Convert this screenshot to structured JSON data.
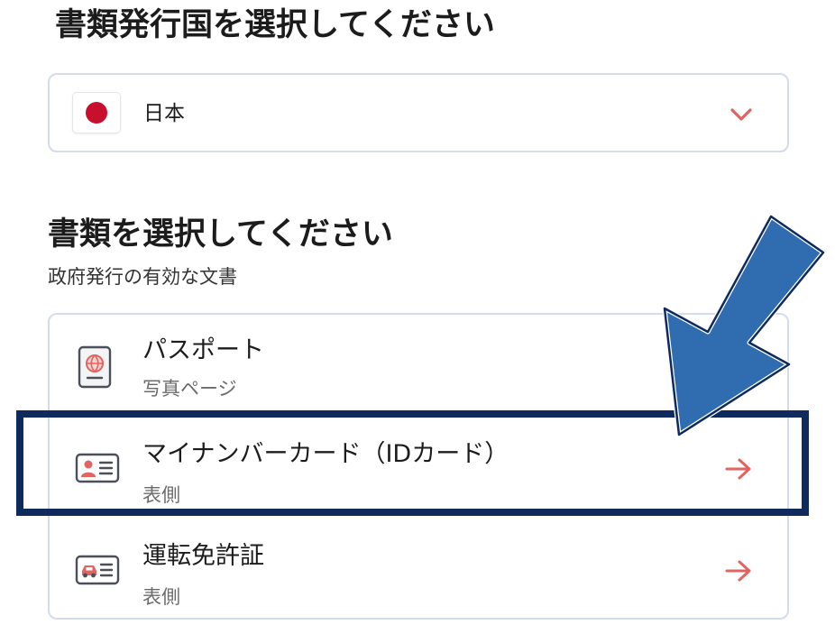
{
  "country_section": {
    "heading": "書類発行国を選択してください",
    "selected_country": "日本",
    "flag_icon": "japan-flag-icon",
    "dropdown_icon": "chevron-down-icon"
  },
  "document_section": {
    "heading": "書類を選択してください",
    "subheading": "政府発行の有効な文書",
    "items": [
      {
        "title": "パスポート",
        "subtitle": "写真ページ",
        "icon": "passport-icon"
      },
      {
        "title": "マイナンバーカード（IDカード）",
        "subtitle": "表側",
        "icon": "id-card-icon"
      },
      {
        "title": "運転免許証",
        "subtitle": "表側",
        "icon": "driver-license-icon"
      }
    ]
  },
  "colors": {
    "accent_red": "#e0645f",
    "flag_red": "#c8102e",
    "highlight_navy": "#0f2a5c",
    "pointer_blue": "#2f6db0",
    "border_gray": "#d3dce8"
  }
}
